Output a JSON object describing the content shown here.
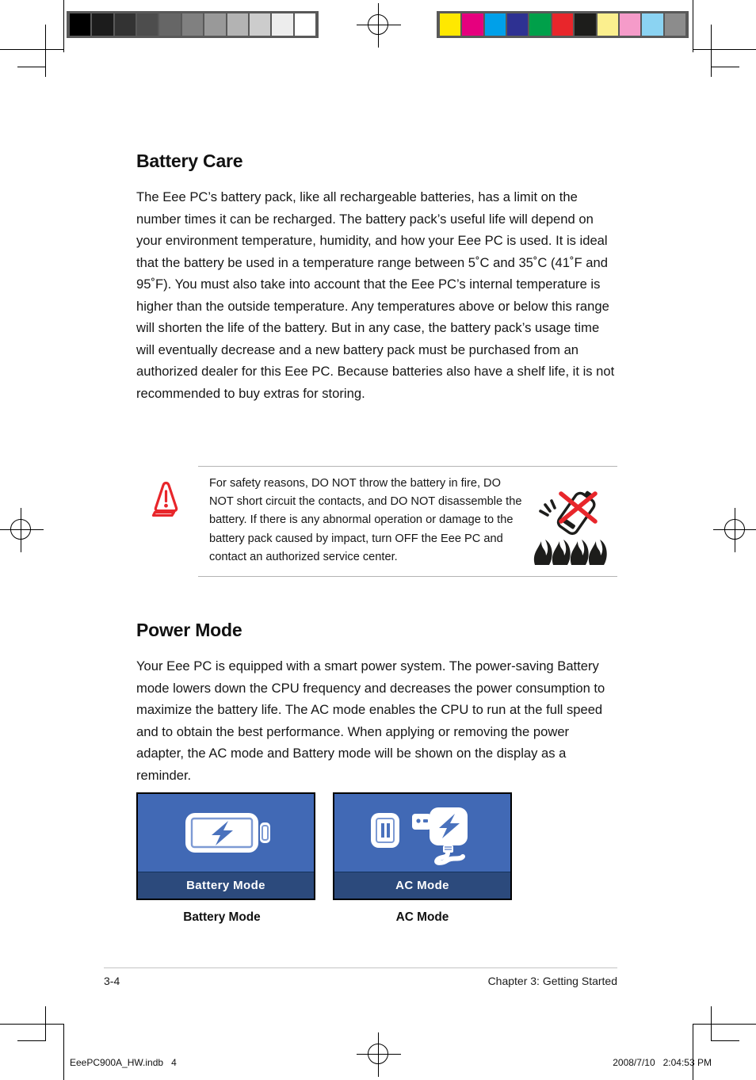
{
  "document": {
    "page_number": "3-4",
    "footer_chapter": "Chapter 3: Getting Started",
    "imposition_file": "EeePC900A_HW.indb   4",
    "imposition_timestamp": "2008/7/10   2:04:53 PM"
  },
  "sections": [
    {
      "heading": "Battery Care",
      "body": "The Eee PC’s battery pack, like all rechargeable batteries, has a limit on the number times it can be recharged. The battery pack’s useful life will depend on your environment temperature, humidity, and how your Eee PC is used. It is ideal that the battery be used in a temperature range between 5˚C and 35˚C (41˚F and 95˚F). You must also take into account that the Eee PC’s internal temperature is higher than the outside temperature. Any temperatures above or below this range will shorten the life of the battery. But in any case, the battery pack’s usage time will eventually decrease and a new battery pack must be purchased from an authorized dealer for this Eee PC. Because batteries also have a shelf life, it is not recommended to buy extras for storing."
    },
    {
      "heading": "Power Mode",
      "body": "Your Eee PC is equipped with a smart power system. The power-saving Battery mode lowers down the CPU frequency and decreases the power consumption to maximize the battery life. The AC mode enables the CPU to run at the full speed and to obtain the best performance. When applying or removing the power adapter, the AC mode and Battery mode will be shown on the display as a reminder."
    }
  ],
  "warning_note": {
    "icon": "warning-cone-icon",
    "icon_color": "#e8262b",
    "text": "For safety reasons, DO NOT throw the battery in fire, DO NOT short circuit the contacts, and DO NOT disassemble the battery. If there is any abnormal operation or damage to the battery pack caused by impact, turn OFF the Eee PC and contact an authorized service center.",
    "graphic": "no-battery-in-fire-icon"
  },
  "figures": [
    {
      "panel_label": "Battery Mode",
      "caption": "Battery Mode",
      "icon": "battery-charging-icon",
      "panel_bg": "#4169B5",
      "label_bg": "#2C4A7C"
    },
    {
      "panel_label": "AC Mode",
      "caption": "AC Mode",
      "icon": "ac-adapter-icon",
      "panel_bg": "#4169B5",
      "label_bg": "#2C4A7C"
    }
  ],
  "print_marks": {
    "grayscale_swatches": [
      "#000000",
      "#1c1c1c",
      "#333333",
      "#4d4d4d",
      "#666666",
      "#808080",
      "#999999",
      "#b3b3b3",
      "#cccccc",
      "#ededed",
      "#ffffff"
    ],
    "color_swatches": [
      "#ffe800",
      "#e6007e",
      "#00a0e9",
      "#2e3192",
      "#00a04a",
      "#e8262b",
      "#1d1d1b",
      "#fbef8e",
      "#f59bc9",
      "#8bd3f2",
      "#8c8c8c"
    ],
    "registration_mark": "registration-crosshair-icon"
  }
}
